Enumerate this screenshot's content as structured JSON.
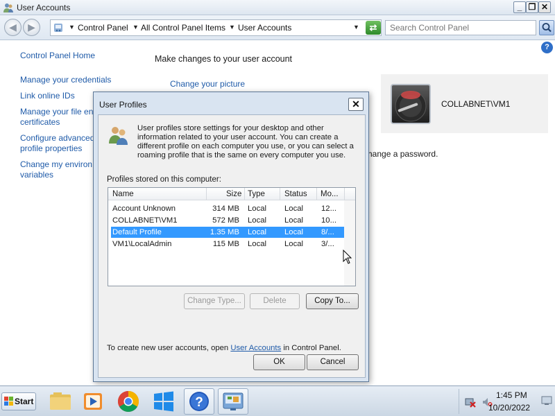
{
  "window": {
    "title": "User Accounts",
    "colors": {
      "link": "#1e5aa8",
      "selection": "#3399ff"
    }
  },
  "address": {
    "breadcrumbs": [
      "Control Panel",
      "All Control Panel Items",
      "User Accounts"
    ],
    "search_placeholder": "Search Control Panel"
  },
  "sidebar": {
    "items": [
      {
        "label": "Control Panel Home"
      },
      {
        "label": "Manage your credentials"
      },
      {
        "label": "Link online IDs"
      },
      {
        "label": "Manage your file en",
        "label2": "certificates"
      },
      {
        "label": "Configure advanced",
        "label2": "profile properties"
      },
      {
        "label": "Change my environ",
        "label2": "variables"
      }
    ]
  },
  "main": {
    "heading": "Make changes to your user account",
    "change_picture": "Change your picture",
    "behind_text": "hange a password.",
    "account_name": "COLLABNET\\VM1"
  },
  "dialog": {
    "title": "User Profiles",
    "description": "User profiles store settings for your desktop and other information related to your user account. You can create a different profile on each computer you use, or you can select a roaming profile that is the same on every computer you use.",
    "profiles_label": "Profiles stored on this computer:",
    "columns": [
      "Name",
      "Size",
      "Type",
      "Status",
      "Mo..."
    ],
    "rows": [
      {
        "name": "Account Unknown",
        "size": "314 MB",
        "type": "Local",
        "status": "Local",
        "modified": "12..."
      },
      {
        "name": "COLLABNET\\VM1",
        "size": "572 MB",
        "type": "Local",
        "status": "Local",
        "modified": "10..."
      },
      {
        "name": "Default Profile",
        "size": "1.35 MB",
        "type": "Local",
        "status": "Local",
        "modified": "8/...",
        "selected": true
      },
      {
        "name": "VM1\\LocalAdmin",
        "size": "115 MB",
        "type": "Local",
        "status": "Local",
        "modified": "3/..."
      }
    ],
    "buttons": {
      "change_type": "Change Type...",
      "delete": "Delete",
      "copy_to": "Copy To...",
      "ok": "OK",
      "cancel": "Cancel"
    },
    "create_prefix": "To create new user accounts, open ",
    "create_link": "User Accounts",
    "create_suffix": " in Control Panel."
  },
  "taskbar": {
    "start_label": "Start",
    "apps": [
      "file-explorer-icon",
      "media-player-icon",
      "chrome-icon",
      "windows-icon",
      "help-icon",
      "control-panel-icon"
    ],
    "time": "1:45 PM",
    "date": "10/20/2022"
  }
}
